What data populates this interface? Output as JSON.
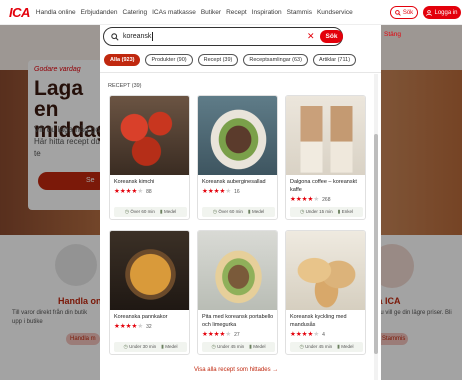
{
  "nav": {
    "logo": "ICA",
    "links": [
      "Handla online",
      "Erbjudanden",
      "Catering",
      "ICAs matkasse",
      "Butiker",
      "Recept",
      "Inspiration",
      "Stammis",
      "Kundservice"
    ],
    "search_button": "Sök",
    "login_button": "Logga in"
  },
  "background": {
    "hero_tag": "Godare vardag",
    "hero_title": "Laga en middag",
    "hero_text": "Vill du laga någ gott? Här hitta recept du vill te",
    "hero_button": "Se",
    "left_heading": "Handla onli",
    "left_text": "Till varor direkt från din butik upp i butike",
    "left_pill": "Handla m",
    "right_heading": "is på ICA",
    "right_text": "som du vill ge din lägre priser. Bli",
    "right_pill": "Stammis"
  },
  "search": {
    "value": "koreansk",
    "submit_label": "Sök",
    "close_label": "Stäng"
  },
  "filters": [
    {
      "label": "Alla (923)",
      "active": true
    },
    {
      "label": "Produkter (90)",
      "active": false
    },
    {
      "label": "Recept (39)",
      "active": false
    },
    {
      "label": "Receptsamlingar (63)",
      "active": false
    },
    {
      "label": "Artiklar (711)",
      "active": false
    }
  ],
  "section_label": "RECEPT (39)",
  "recipes": [
    {
      "title": "Koreansk kimchi",
      "rating": 4,
      "count": "88",
      "time": "Över 60 min",
      "level": "Medel"
    },
    {
      "title": "Koreansk auberginesallad",
      "rating": 4,
      "count": "16",
      "time": "Över 60 min",
      "level": "Medel"
    },
    {
      "title": "Dalgona coffee – koreanskt kaffe",
      "rating": 4,
      "count": "268",
      "time": "Under 15 min",
      "level": "Enkel"
    },
    {
      "title": "Koreanska pannkakor",
      "rating": 4,
      "count": "32",
      "time": "Under 30 min",
      "level": "Medel"
    },
    {
      "title": "Pita med koreansk portabello och limegurka",
      "rating": 4,
      "count": "27",
      "time": "Under 45 min",
      "level": "Medel"
    },
    {
      "title": "Koreansk kyckling med mandusås",
      "rating": 4,
      "count": "4",
      "time": "Under 45 min",
      "level": "Medel"
    }
  ],
  "more_link": "Visa alla recept som hittades →",
  "colors": {
    "brand_red": "#e3000b",
    "chip_active": "#c0280f"
  }
}
